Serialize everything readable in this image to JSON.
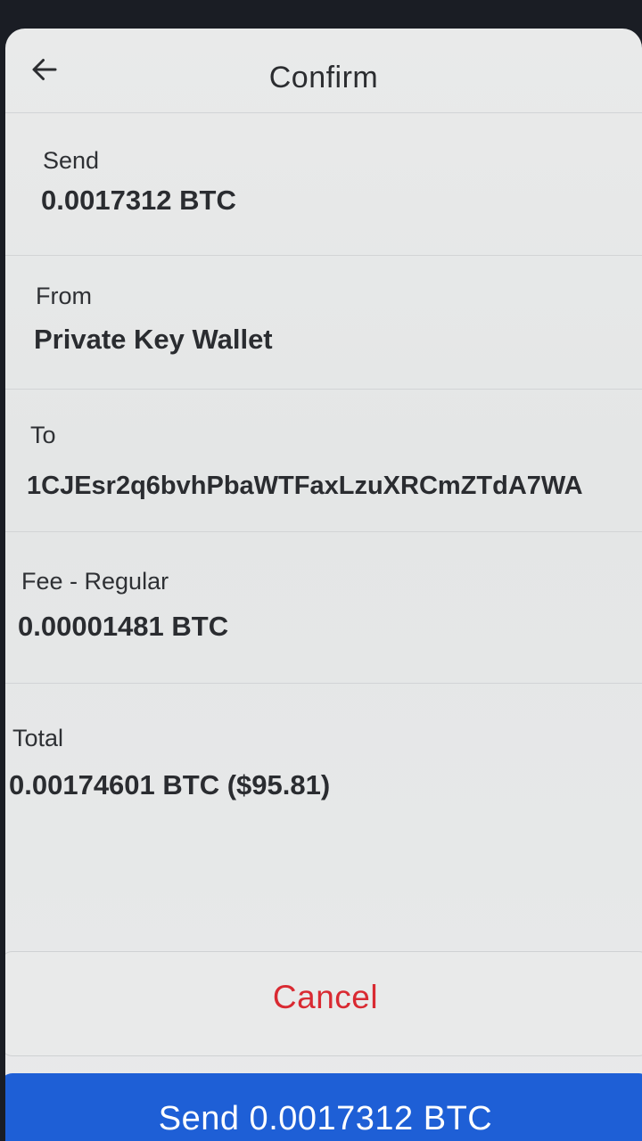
{
  "header": {
    "title": "Confirm",
    "back_icon": "arrow-left-icon"
  },
  "send": {
    "label": "Send",
    "value": "0.0017312 BTC"
  },
  "from": {
    "label": "From",
    "value": "Private Key Wallet"
  },
  "to": {
    "label": "To",
    "value": "1CJEsr2q6bvhPbaWTFaxLzuXRCmZTdA7WA"
  },
  "fee": {
    "label": "Fee - Regular",
    "value": "0.00001481 BTC"
  },
  "total": {
    "label": "Total",
    "value": "0.00174601 BTC ($95.81)"
  },
  "actions": {
    "cancel_label": "Cancel",
    "send_label": "Send 0.0017312 BTC"
  },
  "colors": {
    "primary": "#1e5fd6",
    "danger": "#d92a32",
    "background": "#e9eaea"
  }
}
